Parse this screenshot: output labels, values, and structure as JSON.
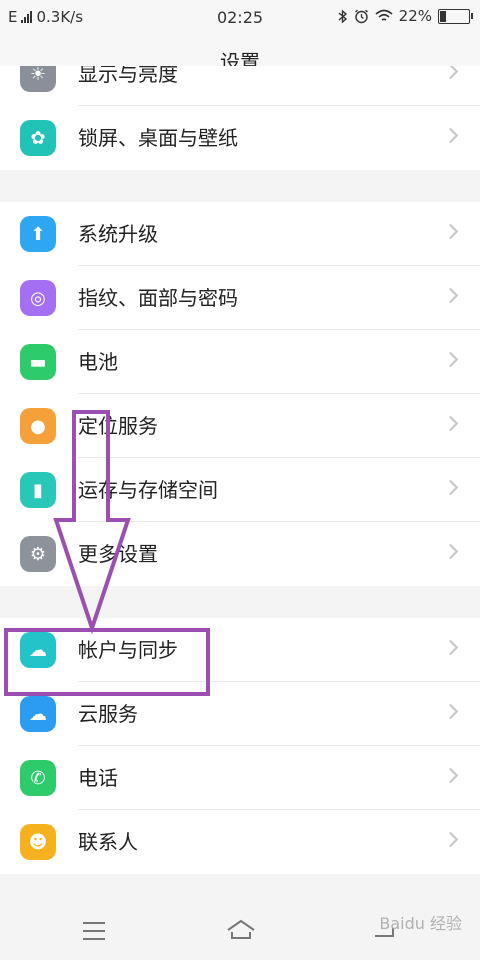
{
  "status_bar": {
    "network_label": "E",
    "speed": "0.3K/s",
    "time": "02:25",
    "battery": "22%",
    "battery_level": 0.22
  },
  "header": {
    "title": "设置"
  },
  "settings": [
    {
      "id": "display",
      "label": "显示与亮度",
      "icon": "sun-icon",
      "color": "#8a8f99"
    },
    {
      "id": "lockscreen",
      "label": "锁屏、桌面与壁纸",
      "icon": "palette-icon",
      "color": "#20c3b5"
    },
    {
      "id": "update",
      "label": "系统升级",
      "icon": "upgrade-icon",
      "color": "#2ea7f2"
    },
    {
      "id": "fingerprint",
      "label": "指纹、面部与密码",
      "icon": "fingerprint-icon",
      "color": "#a46ff2"
    },
    {
      "id": "battery",
      "label": "电池",
      "icon": "battery-icon",
      "color": "#2ecb6b"
    },
    {
      "id": "location",
      "label": "定位服务",
      "icon": "location-pin-icon",
      "color": "#f6a03a"
    },
    {
      "id": "storage",
      "label": "运存与存储空间",
      "icon": "sd-card-icon",
      "color": "#28c7b8"
    },
    {
      "id": "more",
      "label": "更多设置",
      "icon": "gear-icon",
      "color": "#8e929b"
    },
    {
      "id": "account",
      "label": "帐户与同步",
      "icon": "cloud-sync-icon",
      "color": "#22c4c9"
    },
    {
      "id": "cloud",
      "label": "云服务",
      "icon": "cloud-icon",
      "color": "#2b9cf2"
    },
    {
      "id": "phone",
      "label": "电话",
      "icon": "phone-icon",
      "color": "#2ecb6b"
    },
    {
      "id": "contacts",
      "label": "联系人",
      "icon": "contact-icon",
      "color": "#f6b21e"
    }
  ],
  "annotation": {
    "color": "#9b4fb0"
  },
  "watermark": {
    "text": "Baidu 经验"
  }
}
